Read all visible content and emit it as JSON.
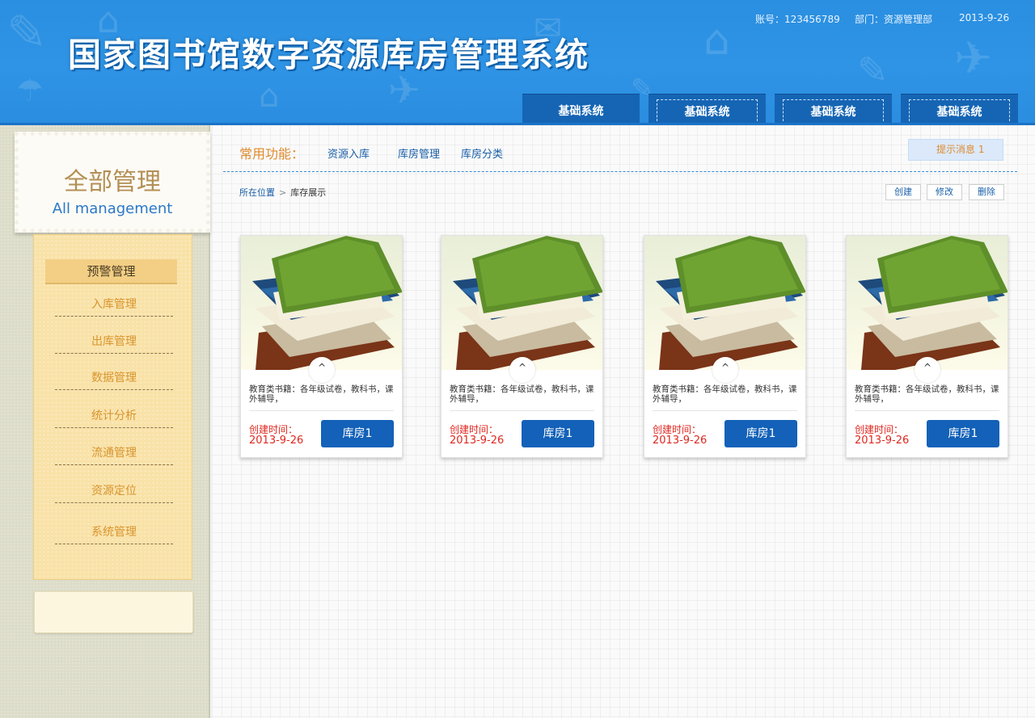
{
  "header": {
    "title": "国家图书馆数字资源库房管理系统",
    "account": "账号：123456789",
    "department": "部门：资源管理部",
    "date": "2013-9-26",
    "nav_tabs": [
      "基础系统",
      "基础系统",
      "基础系统",
      "基础系统"
    ]
  },
  "sidebar": {
    "title_cn": "全部管理",
    "title_en": "All management",
    "active_item": "预警管理",
    "items": [
      "入库管理",
      "出库管理",
      "数据管理",
      "统计分析",
      "流通管理",
      "资源定位",
      "系统管理"
    ]
  },
  "quick": {
    "label": "常用功能：",
    "links": [
      "资源入库",
      "库房管理",
      "库房分类"
    ]
  },
  "notice": {
    "text": "提示消息 1"
  },
  "breadcrumb": {
    "location": "所在位置",
    "separator": ">",
    "current": "库存展示"
  },
  "actions": [
    "创建",
    "修改",
    "删除"
  ],
  "cards": [
    {
      "desc": "教育类书籍：各年级试卷，教科书，课外辅导，",
      "created_label": "创建时间：",
      "created_date": "2013-9-26",
      "button": "库房1",
      "toggle": "^"
    },
    {
      "desc": "教育类书籍：各年级试卷，教科书，课外辅导，",
      "created_label": "创建时间：",
      "created_date": "2013-9-26",
      "button": "库房1",
      "toggle": "^"
    },
    {
      "desc": "教育类书籍：各年级试卷，教科书，课外辅导，",
      "created_label": "创建时间：",
      "created_date": "2013-9-26",
      "button": "库房1",
      "toggle": "^"
    },
    {
      "desc": "教育类书籍：各年级试卷，教科书，课外辅导，",
      "created_label": "创建时间：",
      "created_date": "2013-9-26",
      "button": "库房1",
      "toggle": "^"
    }
  ],
  "colors": {
    "header_blue": "#2f94e6",
    "nav_tab_blue": "#1565b4",
    "accent_orange": "#e08a2e",
    "date_red": "#e0271f",
    "button_blue": "#1361b8",
    "menu_bg": "#f9e2a8"
  },
  "icons": {
    "toggle": "chevron-up-icon",
    "books": "book-stack-icon"
  }
}
